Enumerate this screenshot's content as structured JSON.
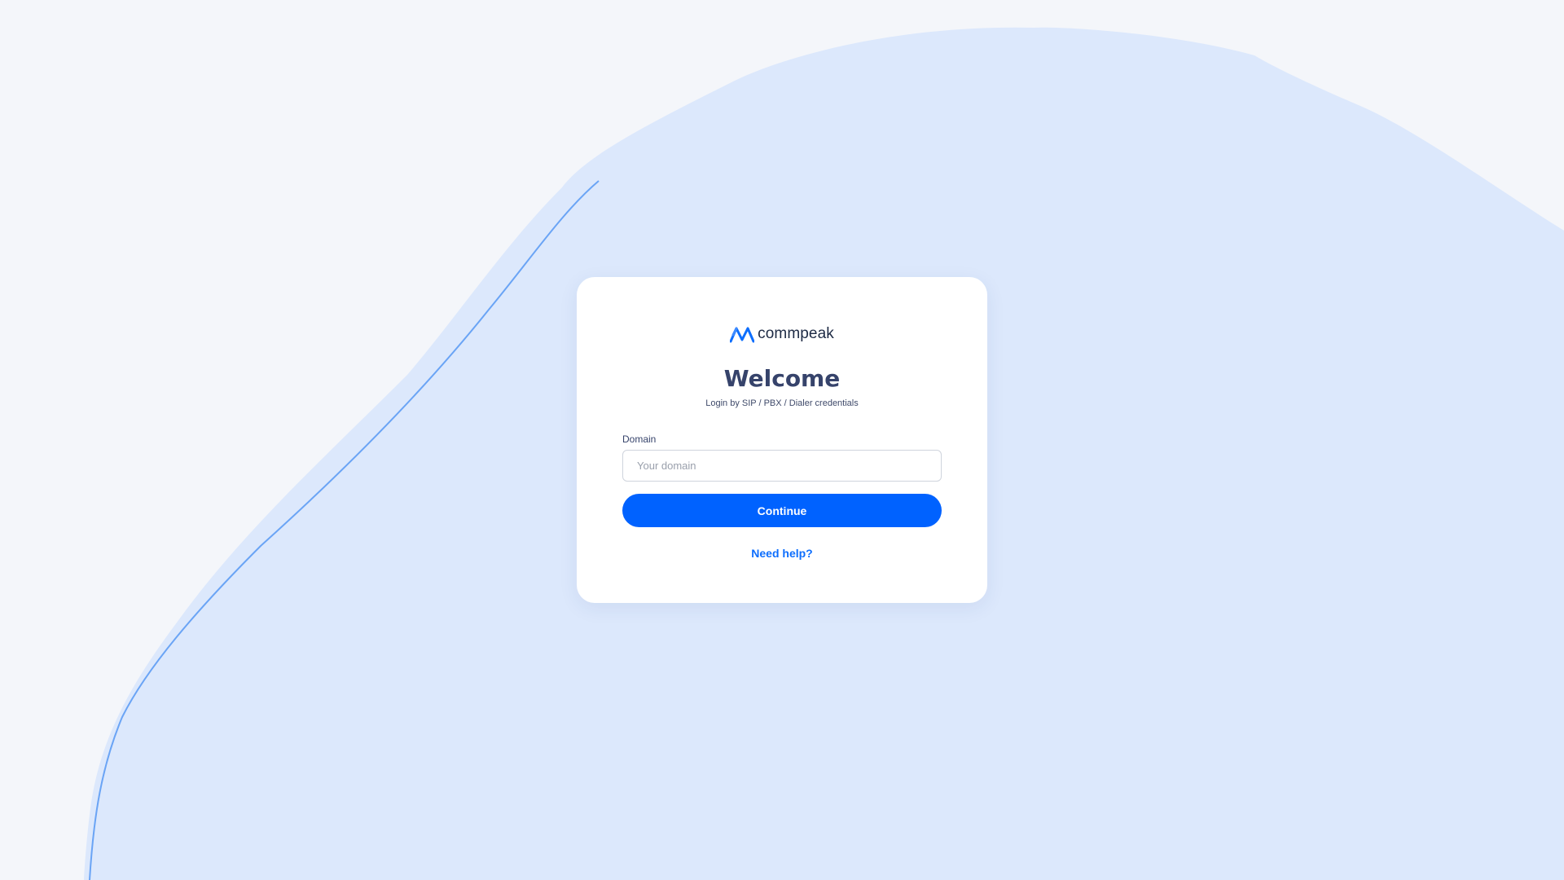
{
  "brand": {
    "name": "commpeak",
    "icon": "mountain-peaks-logo-icon",
    "accent_color": "#0062ff"
  },
  "header": {
    "title": "Welcome",
    "subtitle": "Login by SIP / PBX / Dialer credentials"
  },
  "form": {
    "domain_label": "Domain",
    "domain_placeholder": "Your domain",
    "domain_value": "",
    "continue_label": "Continue",
    "help_label": "Need help?"
  },
  "colors": {
    "background": "#f4f6fa",
    "blob": "#dce8fc",
    "card": "#ffffff",
    "title": "#36436b",
    "link": "#0d6efd"
  }
}
